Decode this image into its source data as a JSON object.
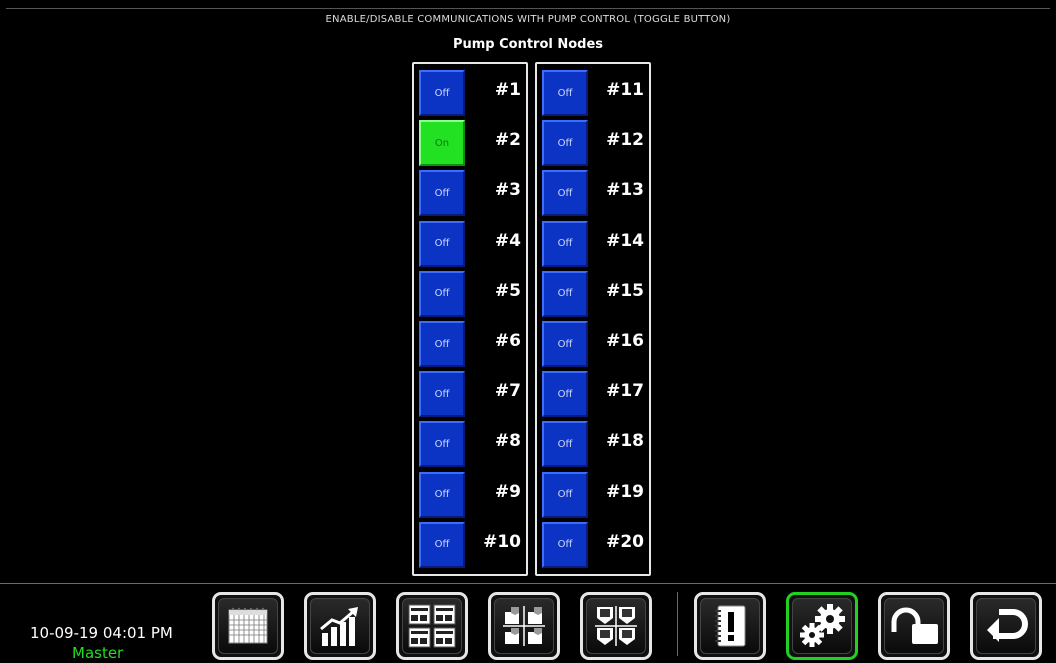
{
  "header": {
    "instruction": "ENABLE/DISABLE COMMUNICATIONS WITH PUMP CONTROL (TOGGLE BUTTON)",
    "title": "Pump Control Nodes"
  },
  "nodes": {
    "left": [
      {
        "label": "#1",
        "state": "Off"
      },
      {
        "label": "#2",
        "state": "On"
      },
      {
        "label": "#3",
        "state": "Off"
      },
      {
        "label": "#4",
        "state": "Off"
      },
      {
        "label": "#5",
        "state": "Off"
      },
      {
        "label": "#6",
        "state": "Off"
      },
      {
        "label": "#7",
        "state": "Off"
      },
      {
        "label": "#8",
        "state": "Off"
      },
      {
        "label": "#9",
        "state": "Off"
      },
      {
        "label": "#10",
        "state": "Off"
      }
    ],
    "right": [
      {
        "label": "#11",
        "state": "Off"
      },
      {
        "label": "#12",
        "state": "Off"
      },
      {
        "label": "#13",
        "state": "Off"
      },
      {
        "label": "#14",
        "state": "Off"
      },
      {
        "label": "#15",
        "state": "Off"
      },
      {
        "label": "#16",
        "state": "Off"
      },
      {
        "label": "#17",
        "state": "Off"
      },
      {
        "label": "#18",
        "state": "Off"
      },
      {
        "label": "#19",
        "state": "Off"
      },
      {
        "label": "#20",
        "state": "Off"
      }
    ]
  },
  "taskbar": {
    "datetime": "10-09-19 04:01 PM",
    "user": "Master",
    "buttons": [
      {
        "name": "calendar-icon",
        "active": false
      },
      {
        "name": "trend-chart-icon",
        "active": false
      },
      {
        "name": "display-grid-icon",
        "active": false
      },
      {
        "name": "tags-icon",
        "active": false
      },
      {
        "name": "bins-icon",
        "active": false
      },
      {
        "name": "alarm-notebook-icon",
        "active": false
      },
      {
        "name": "gears-icon",
        "active": true
      },
      {
        "name": "unlock-icon",
        "active": false
      },
      {
        "name": "back-arrow-icon",
        "active": false
      }
    ]
  },
  "colors": {
    "toggle_off": "#0c34c4",
    "toggle_on": "#22e022",
    "active_border": "#22d022",
    "user_text": "#22dd22"
  }
}
